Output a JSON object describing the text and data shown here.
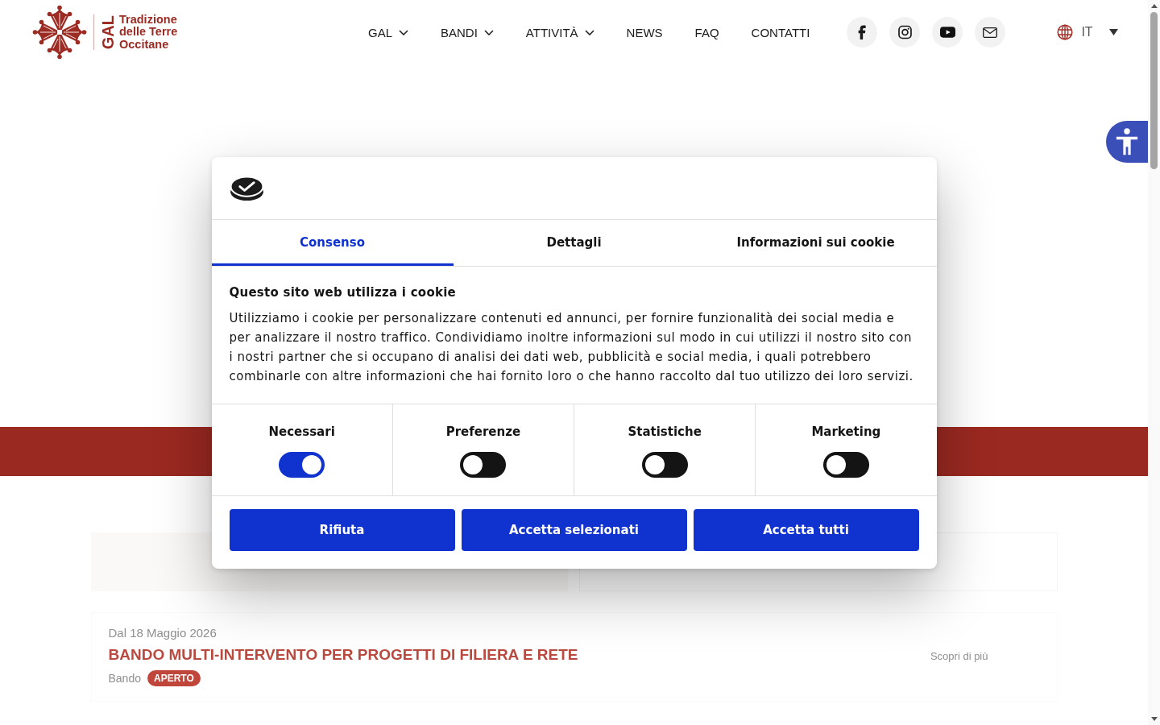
{
  "header": {
    "logo": {
      "acronym": "GAL",
      "lines": [
        "Tradizione",
        "delle Terre",
        "Occitane"
      ]
    },
    "nav": [
      {
        "label": "GAL",
        "has_menu": true
      },
      {
        "label": "BANDI",
        "has_menu": true
      },
      {
        "label": "ATTIVITÀ",
        "has_menu": true
      },
      {
        "label": "NEWS",
        "has_menu": false
      },
      {
        "label": "FAQ",
        "has_menu": false
      },
      {
        "label": "CONTATTI",
        "has_menu": false
      }
    ],
    "language": {
      "label": "IT"
    }
  },
  "listing": {
    "date": "Dal 18 Maggio 2026",
    "title": "BANDO MULTI-INTERVENTO PER PROGETTI DI FILIERA E RETE",
    "type": "Bando",
    "status": "APERTO",
    "link": "Scopri di più"
  },
  "cookie_dialog": {
    "tabs": [
      {
        "label": "Consenso",
        "selected": true
      },
      {
        "label": "Dettagli",
        "selected": false
      },
      {
        "label": "Informazioni sui cookie",
        "selected": false
      }
    ],
    "heading": "Questo sito web utilizza i cookie",
    "text": "Utilizziamo i cookie per personalizzare contenuti ed annunci, per fornire funzionalità dei social media e per analizzare il nostro traffico. Condividiamo inoltre informazioni sul modo in cui utilizzi il nostro sito con i nostri partner che si occupano di analisi dei dati web, pubblicità e social media, i quali potrebbero combinarle con altre informazioni che hai fornito loro o che hanno raccolto dal tuo utilizzo dei loro servizi.",
    "categories": [
      {
        "label": "Necessari",
        "on": true
      },
      {
        "label": "Preferenze",
        "on": false
      },
      {
        "label": "Statistiche",
        "on": false
      },
      {
        "label": "Marketing",
        "on": false
      }
    ],
    "buttons": [
      "Rifiuta",
      "Accetta selezionati",
      "Accetta tutti"
    ]
  }
}
